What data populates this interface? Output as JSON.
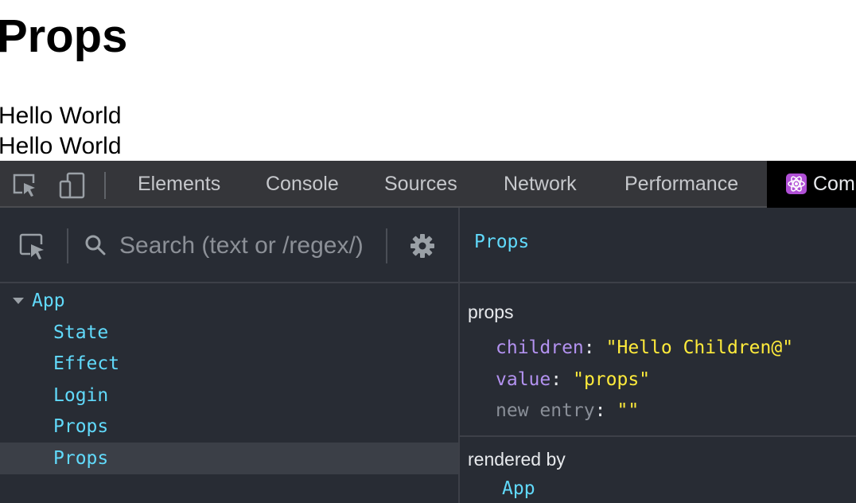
{
  "page": {
    "heading": "Props",
    "lines": [
      "Hello World",
      "Hello World"
    ]
  },
  "devtools": {
    "tabs": {
      "elements": "Elements",
      "console": "Console",
      "sources": "Sources",
      "network": "Network",
      "performance": "Performance",
      "components": "Com"
    },
    "search": {
      "placeholder": "Search (text or /regex/)"
    },
    "tree": {
      "root": "App",
      "children": [
        "State",
        "Effect",
        "Login",
        "Props",
        "Props"
      ],
      "selected_index": 4
    },
    "detail": {
      "component_name": "Props",
      "props_title": "props",
      "props": [
        {
          "key": "children",
          "value": "\"Hello Children@\""
        },
        {
          "key": "value",
          "value": "\"props\""
        },
        {
          "key": "new entry",
          "value": "\"\""
        }
      ],
      "rendered_by_title": "rendered by",
      "rendered_by": "App"
    },
    "colors": {
      "background": "#282c34",
      "component_name": "#61dafb",
      "prop_key": "#b392f0",
      "prop_value": "#ffeb3b",
      "react_logo": "#b04fd6"
    },
    "icons": [
      "inspect-element-icon",
      "device-toolbar-icon",
      "react-logo-icon",
      "select-component-icon",
      "search-icon",
      "gear-icon",
      "expand-triangle-icon"
    ]
  }
}
